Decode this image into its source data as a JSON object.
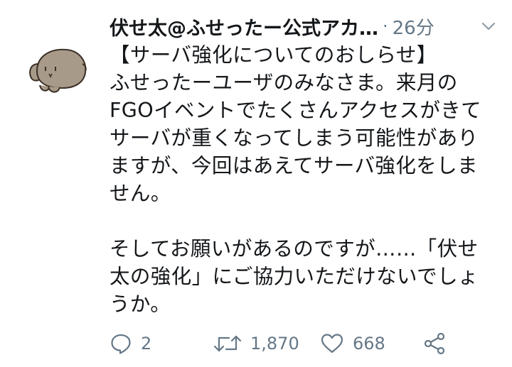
{
  "author": {
    "display_name": "伏せ太@ふせったー公式アカ…",
    "separator": "·",
    "time_ago": "26分",
    "avatar": "bunny-avatar-icon"
  },
  "tweet": {
    "lines_1": [
      "【サーバ強化についてのおしらせ】",
      "ふせったーユーザのみなさま。来月の",
      "FGOイベントでたくさんアクセスがきて",
      "サーバが重くなってしまう可能性があり",
      "ますが、今回はあえてサーバ強化をしま",
      "せん。"
    ],
    "lines_2": [
      "そしてお願いがあるのですが……「伏せ",
      "太の強化」にご協力いただけないでしょ",
      "うか。"
    ]
  },
  "actions": {
    "reply_count": "2",
    "retweet_count": "1,870",
    "like_count": "668"
  },
  "icons": {
    "reply": "reply-bubble-icon",
    "retweet": "retweet-icon",
    "like": "heart-icon",
    "share": "share-icon",
    "menu": "chevron-down-icon"
  },
  "colors": {
    "text": "#14171a",
    "secondary": "#657786"
  }
}
